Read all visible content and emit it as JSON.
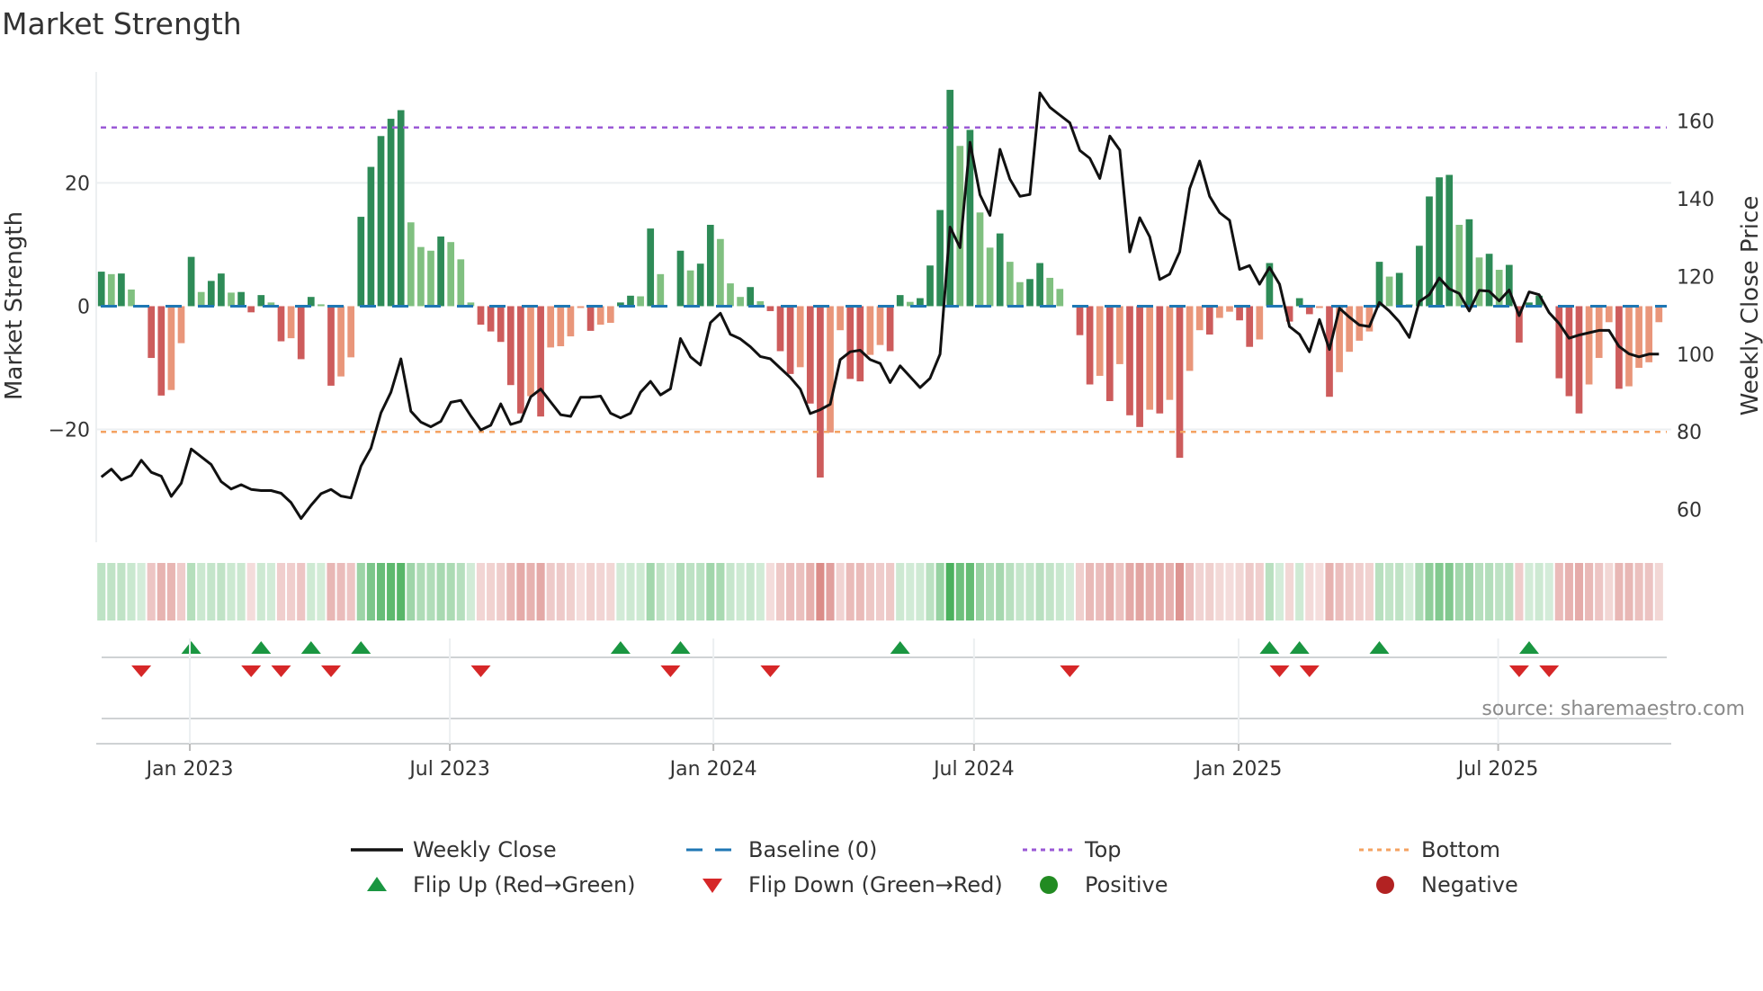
{
  "title": "Market Strength",
  "source": "source: sharemaestro.com",
  "colors": {
    "pos_strong": "#2e8b57",
    "pos_weak": "#80c080",
    "neg_strong": "#cd5c5c",
    "neg_weak": "#e9967a",
    "top": "#9b59d6",
    "bottom": "#f4a261",
    "baseline": "#1f77b4",
    "close": "#111111",
    "flip_up": "#1a9641",
    "flip_down": "#d62728",
    "positive": "#228b22",
    "negative": "#b22222"
  },
  "chart_data": {
    "type": "bar",
    "title": "Market Strength",
    "ylabel": "Market Strength",
    "y2label": "Weekly Close Price",
    "ylim": [
      -38.3,
      38.0
    ],
    "y2lim": [
      51.6,
      172.6
    ],
    "yticks": [
      {
        "v": 20,
        "label": "20"
      },
      {
        "v": 0,
        "label": "0"
      },
      {
        "v": -20,
        "label": "−20"
      }
    ],
    "y2ticks": [
      {
        "v": 60,
        "label": "60"
      },
      {
        "v": 80,
        "label": "80"
      },
      {
        "v": 100,
        "label": "100"
      },
      {
        "v": 120,
        "label": "120"
      },
      {
        "v": 140,
        "label": "140"
      },
      {
        "v": 160,
        "label": "160"
      }
    ],
    "xticks": [
      {
        "week": 8.86,
        "label": "Jan 2023"
      },
      {
        "week": 34.9,
        "label": "Jul 2023"
      },
      {
        "week": 61.3,
        "label": "Jan 2024"
      },
      {
        "week": 87.4,
        "label": "Jul 2024"
      },
      {
        "week": 113.9,
        "label": "Jan 2025"
      },
      {
        "week": 139.9,
        "label": "Jul 2025"
      }
    ],
    "top": 29.0,
    "bottom": -20.4,
    "baseline": 0,
    "strength": [
      5.6,
      5.2,
      5.3,
      2.7,
      0,
      -8.4,
      -14.5,
      -13.6,
      -6.0,
      8.0,
      2.3,
      4.1,
      5.3,
      2.2,
      2.3,
      -1.0,
      1.8,
      0.6,
      -5.7,
      -5.2,
      -8.6,
      1.5,
      0.3,
      -12.9,
      -11.4,
      -8.3,
      14.5,
      22.6,
      27.6,
      30.4,
      31.8,
      13.6,
      9.6,
      9.0,
      11.3,
      10.4,
      7.6,
      0.6,
      -3.0,
      -4.1,
      -5.8,
      -12.8,
      -17.4,
      -14.6,
      -17.9,
      -6.7,
      -6.5,
      -4.9,
      -0.3,
      -4.0,
      -3.0,
      -2.7,
      0.6,
      1.7,
      1.6,
      12.6,
      5.2,
      0,
      9.0,
      5.8,
      6.9,
      13.2,
      10.9,
      3.7,
      1.5,
      3.1,
      0.8,
      -0.8,
      -7.3,
      -11.0,
      -9.9,
      -15.8,
      -27.8,
      -20.5,
      -3.9,
      -11.8,
      -12.2,
      -7.9,
      -6.3,
      -7.3,
      1.8,
      0.7,
      1.3,
      6.6,
      15.6,
      35.1,
      26.0,
      28.6,
      15.2,
      9.5,
      11.8,
      7.2,
      3.9,
      4.4,
      7.0,
      4.6,
      2.8,
      0,
      -4.7,
      -12.7,
      -11.3,
      -15.4,
      -9.4,
      -17.7,
      -19.6,
      -16.8,
      -17.4,
      -15.2,
      -24.6,
      -10.5,
      -3.9,
      -4.6,
      -1.9,
      -0.9,
      -2.3,
      -6.6,
      -5.4,
      7.0,
      0,
      -2.5,
      1.3,
      -1.3,
      -0.3,
      -14.7,
      -10.7,
      -7.4,
      -5.6,
      -4.1,
      7.2,
      4.8,
      5.4,
      0.3,
      9.8,
      17.8,
      20.9,
      21.3,
      13.2,
      14.1,
      7.9,
      8.5,
      5.9,
      6.7,
      -5.9,
      0.6,
      1.7,
      0,
      -11.7,
      -14.6,
      -17.4,
      -12.7,
      -8.4,
      -2.6,
      -13.4,
      -13.0,
      -10.0,
      -9.1,
      -2.6
    ],
    "close": [
      68.4,
      70.4,
      67.6,
      68.8,
      72.7,
      69.6,
      68.6,
      63.4,
      66.8,
      75.6,
      73.6,
      71.6,
      67.2,
      65.3,
      66.4,
      65.2,
      64.9,
      64.9,
      64.2,
      61.8,
      57.7,
      61.1,
      64.1,
      65.2,
      63.5,
      63.0,
      71.2,
      75.8,
      84.9,
      90.2,
      98.8,
      85.3,
      82.5,
      81.3,
      82.7,
      87.6,
      88.1,
      84.1,
      80.5,
      81.7,
      87.2,
      81.9,
      82.7,
      89.0,
      91.0,
      87.7,
      84.4,
      84.0,
      88.9,
      88.9,
      89.2,
      84.8,
      83.6,
      84.8,
      90.2,
      93.0,
      89.5,
      91.1,
      104.0,
      99.3,
      97.2,
      108.1,
      110.5,
      105.1,
      103.9,
      101.9,
      99.4,
      98.8,
      96.4,
      94.0,
      91.0,
      84.7,
      85.7,
      87.1,
      98.6,
      100.6,
      101.0,
      98.6,
      97.6,
      92.7,
      97.0,
      94.2,
      91.4,
      93.8,
      100.0,
      132.7,
      127.4,
      154.5,
      141.0,
      135.7,
      152.7,
      145.0,
      140.6,
      141.1,
      167.2,
      163.5,
      161.5,
      159.5,
      152.4,
      150.4,
      145.2,
      156.1,
      152.5,
      126.3,
      135.1,
      130.2,
      119.2,
      120.6,
      126.3,
      142.6,
      149.7,
      140.6,
      136.4,
      134.4,
      121.8,
      122.8,
      118.0,
      122.3,
      118.0,
      107.1,
      105.1,
      100.6,
      108.9,
      101.2,
      111.8,
      109.5,
      107.5,
      107.1,
      113.3,
      111.1,
      108.3,
      104.3,
      113.5,
      115.3,
      119.6,
      116.8,
      115.6,
      111.1,
      116.4,
      116.2,
      113.7,
      116.5,
      109.9,
      116.0,
      115.3,
      110.7,
      107.9,
      104.1,
      104.9,
      105.5,
      106.1,
      106.1,
      102.0,
      100.1,
      99.3,
      100.0,
      100.0
    ],
    "legend": {
      "placement": "bottom-center",
      "entries": [
        {
          "label": "Weekly Close",
          "kind": "line"
        },
        {
          "label": "Baseline (0)",
          "kind": "dashed"
        },
        {
          "label": "Top",
          "kind": "dotted-top"
        },
        {
          "label": "Bottom",
          "kind": "dotted-bottom"
        },
        {
          "label": "Flip Up (Red→Green)",
          "kind": "tri-up"
        },
        {
          "label": "Flip Down (Green→Red)",
          "kind": "tri-down"
        },
        {
          "label": "Positive",
          "kind": "dot-pos"
        },
        {
          "label": "Negative",
          "kind": "dot-neg"
        }
      ]
    }
  }
}
